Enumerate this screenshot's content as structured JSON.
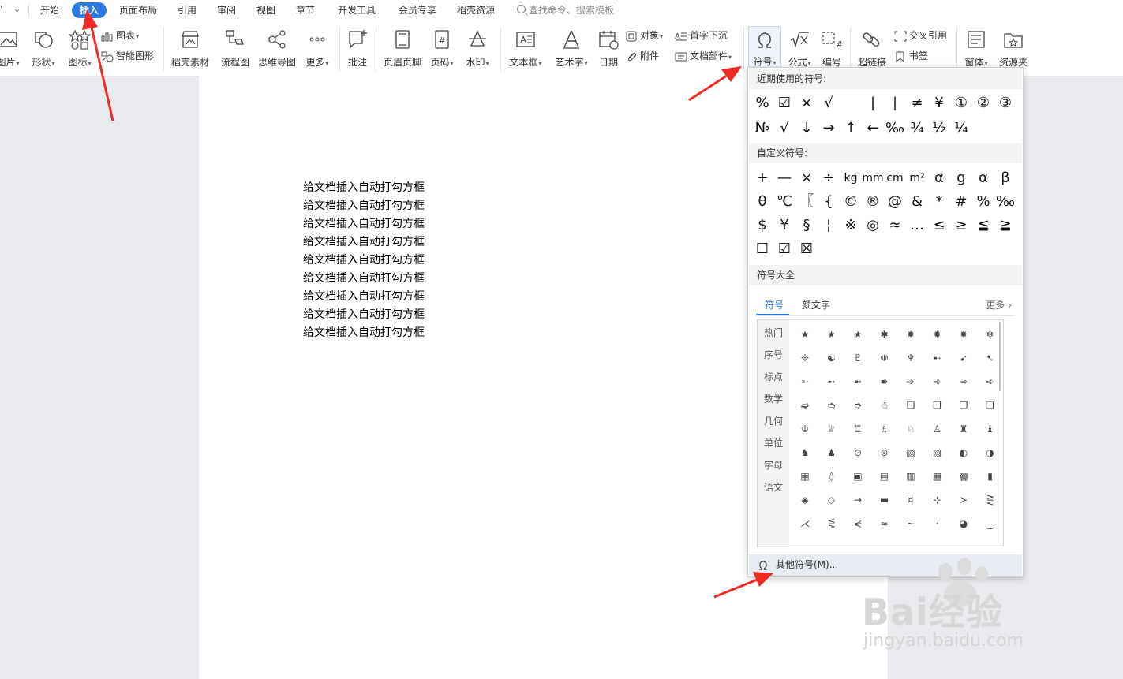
{
  "menu": {
    "quick_access": "⌄",
    "tabs": [
      "开始",
      "插入",
      "页面布局",
      "引用",
      "审阅",
      "视图",
      "章节",
      "开发工具",
      "会员专享",
      "稻壳资源"
    ],
    "active_tab": "插入",
    "search_placeholder": "查找命令、搜索模板"
  },
  "ribbon": {
    "picture": "图片",
    "shape": "形状",
    "icon": "图标",
    "chart": "图表",
    "smart_graphic": "智能图形",
    "daoke_material": "稻壳素材",
    "flowchart": "流程图",
    "mindmap": "思维导图",
    "more": "更多",
    "comment": "批注",
    "header_footer": "页眉页脚",
    "page_number": "页码",
    "watermark": "水印",
    "textbox": "文本框",
    "wordart": "艺术字",
    "date": "日期",
    "object": "对象",
    "attachment": "附件",
    "dropcap": "首字下沉",
    "doc_parts": "文档部件",
    "symbol": "符号",
    "formula": "公式",
    "numbering": "编号",
    "hyperlink": "超链接",
    "cross_ref": "交叉引用",
    "bookmark": "书签",
    "window": "窗体",
    "resource": "资源夹"
  },
  "document": {
    "lines": [
      "给文档插入自动打勾方框",
      "给文档插入自动打勾方框",
      "给文档插入自动打勾方框",
      "给文档插入自动打勾方框",
      "给文档插入自动打勾方框",
      "给文档插入自动打勾方框",
      "给文档插入自动打勾方框",
      "给文档插入自动打勾方框",
      "给文档插入自动打勾方框"
    ]
  },
  "symbol_panel": {
    "recent_title": "近期使用的符号:",
    "recent": [
      [
        "%",
        "☑",
        "×",
        "√",
        "",
        "|",
        "|",
        "≠",
        "¥",
        "①",
        "②",
        "③"
      ],
      [
        "№",
        "√",
        "↓",
        "→",
        "↑",
        "←",
        "‰",
        "¾",
        "½",
        "¼"
      ]
    ],
    "custom_title": "自定义符号:",
    "custom": [
      [
        "+",
        "—",
        "×",
        "÷",
        "kg",
        "mm",
        "cm",
        "m²",
        "α",
        "g",
        "α",
        "β"
      ],
      [
        "θ",
        "℃",
        "〖",
        "{",
        "©",
        "®",
        "@",
        "&",
        "*",
        "#",
        "%",
        "‰"
      ],
      [
        "$",
        "¥",
        "§",
        "¦",
        "※",
        "◎",
        "≈",
        "…",
        "≤",
        "≥",
        "≦",
        "≧"
      ],
      [
        "☐",
        "☑",
        "☒"
      ]
    ],
    "all_title": "符号大全",
    "tabs": [
      "符号",
      "颜文字"
    ],
    "more": "更多",
    "categories": [
      "热门",
      "序号",
      "标点",
      "数学",
      "几何",
      "单位",
      "字母",
      "语文"
    ],
    "grid": [
      [
        "★",
        "★",
        "★",
        "✱",
        "✸",
        "✹",
        "✸",
        "❄"
      ],
      [
        "❊",
        "☯",
        "♇",
        "☫",
        "♆",
        "➸",
        "➹",
        "➷"
      ],
      [
        "➳",
        "➵",
        "➼",
        "➽",
        "➩",
        "➾",
        "⇨",
        "➪"
      ],
      [
        "➫",
        "➬",
        "➮",
        "☃",
        "❑",
        "❒",
        "❐",
        "❏"
      ],
      [
        "♔",
        "♕",
        "♖",
        "♗",
        "♘",
        "♙",
        "♜",
        "♝"
      ],
      [
        "♞",
        "♟",
        "⊙",
        "⊚",
        "▧",
        "▨",
        "◐",
        "◑"
      ],
      [
        "▦",
        "◊",
        "▣",
        "▤",
        "▥",
        "▦",
        "▩",
        "▮"
      ],
      [
        "◈",
        "◇",
        "→",
        "▬",
        "¤",
        "⊹",
        "≻",
        "⋛"
      ],
      [
        "⋌",
        "⋚",
        "⋞",
        "≈",
        "~",
        "·",
        "◕",
        "‿"
      ]
    ],
    "other_symbols": "其他符号(M)..."
  },
  "watermark": {
    "brand": "Bai经验",
    "url": "jingyan.baidu.com"
  }
}
